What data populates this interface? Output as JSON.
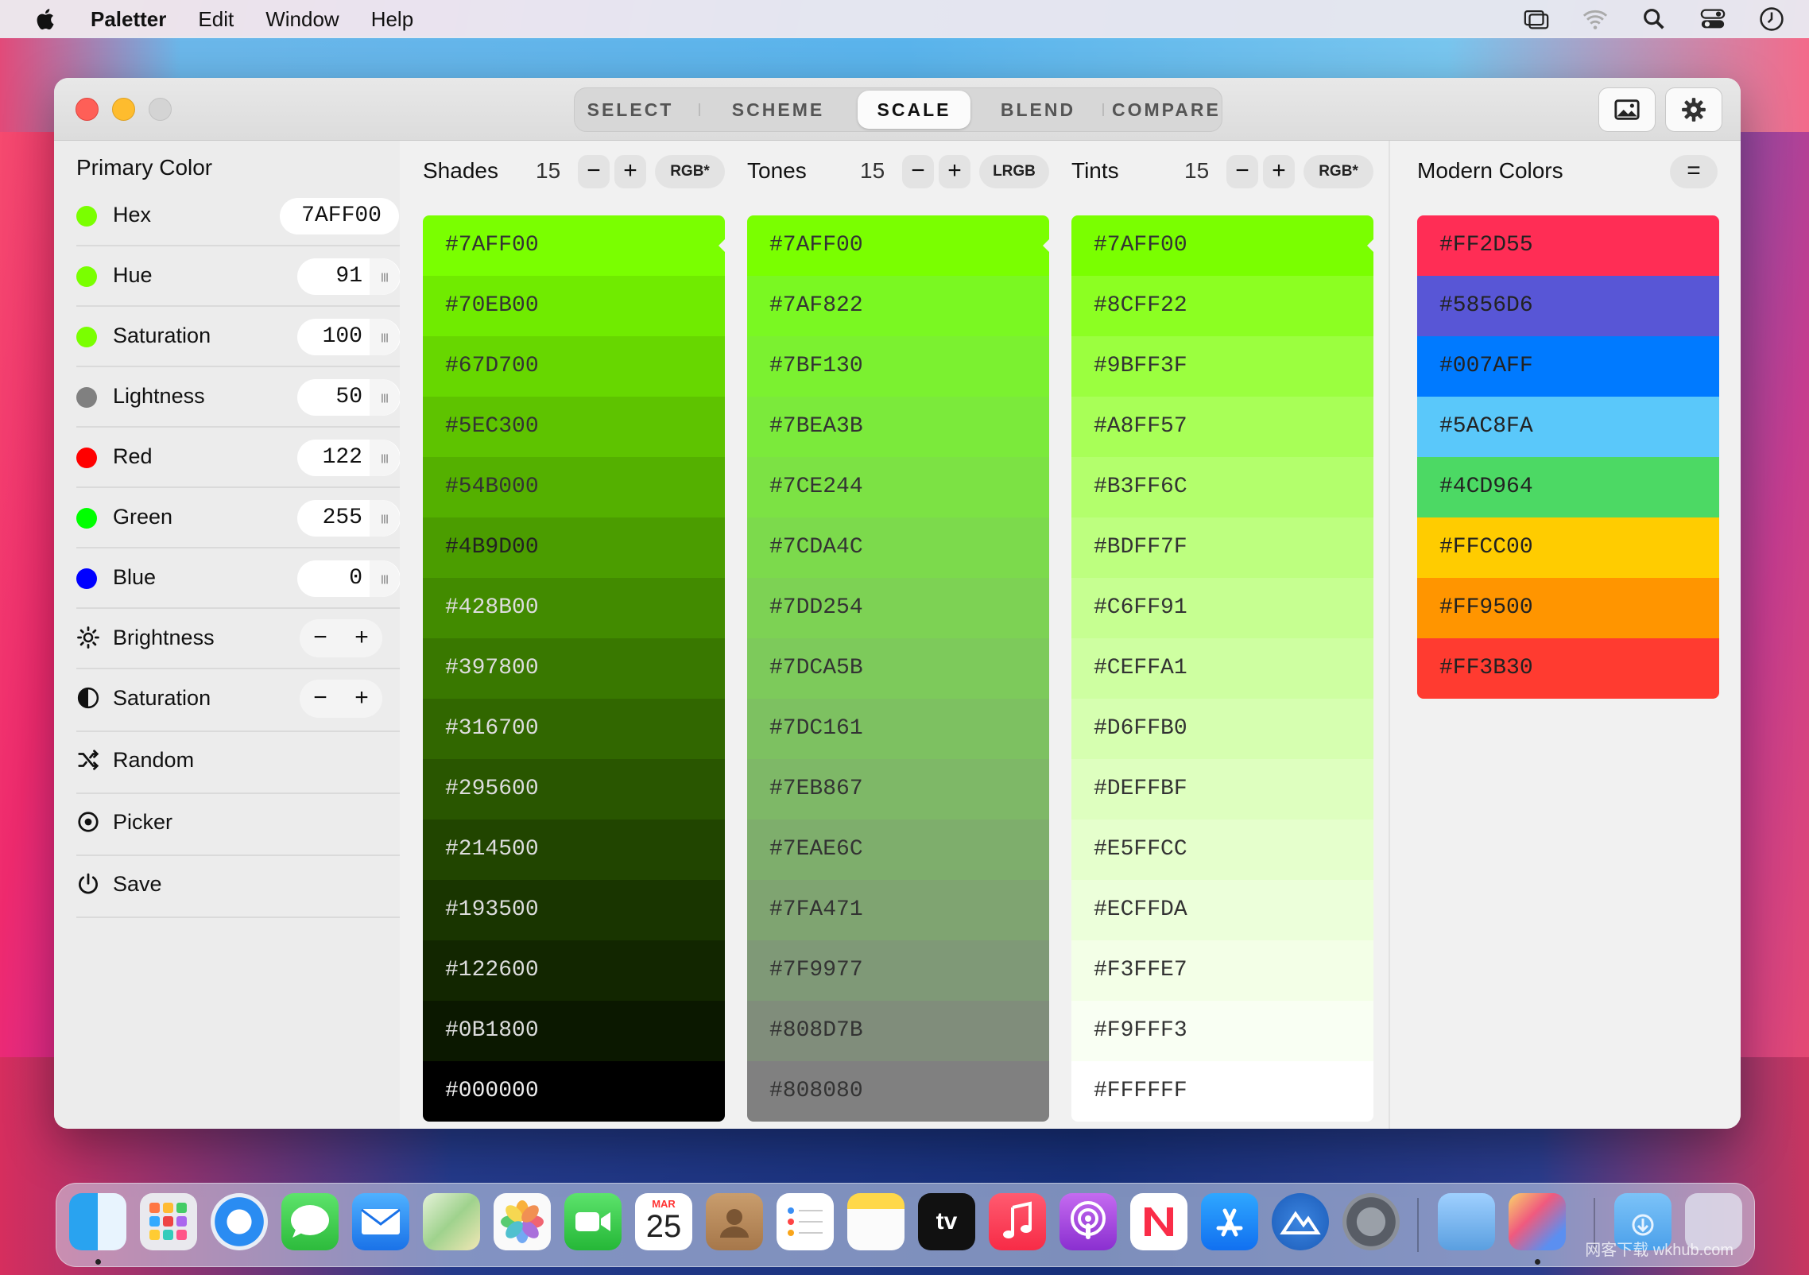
{
  "menubar": {
    "app_name": "Paletter",
    "items": [
      "Edit",
      "Window",
      "Help"
    ],
    "icons": [
      "screen-mirroring-icon",
      "wifi-icon",
      "search-icon",
      "control-center-icon",
      "clock-icon"
    ]
  },
  "toolbar": {
    "tabs": [
      "SELECT",
      "SCHEME",
      "SCALE",
      "BLEND",
      "COMPARE"
    ],
    "active_tab": "SCALE"
  },
  "sidebar": {
    "title": "Primary Color",
    "hex": {
      "label": "Hex",
      "value": "7AFF00",
      "color": "#7AFF00"
    },
    "fields": [
      {
        "label": "Hue",
        "value": "91",
        "color": "#7AFF00"
      },
      {
        "label": "Saturation",
        "value": "100",
        "color": "#7AFF00"
      },
      {
        "label": "Lightness",
        "value": "50",
        "color": "#808080"
      },
      {
        "label": "Red",
        "value": "122",
        "color": "#FF0000"
      },
      {
        "label": "Green",
        "value": "255",
        "color": "#00FF00"
      },
      {
        "label": "Blue",
        "value": "0",
        "color": "#0000FF"
      }
    ],
    "adjusters": [
      {
        "label": "Brightness",
        "icon": "brightness-icon",
        "minus": "−",
        "plus": "+"
      },
      {
        "label": "Saturation",
        "icon": "contrast-icon",
        "minus": "−",
        "plus": "+"
      }
    ],
    "actions": [
      {
        "label": "Random",
        "icon": "shuffle-icon"
      },
      {
        "label": "Picker",
        "icon": "target-icon"
      },
      {
        "label": "Save",
        "icon": "power-icon"
      }
    ]
  },
  "columns": [
    {
      "title": "Shades",
      "count": "15",
      "minus": "−",
      "plus": "+",
      "mode": "RGB*",
      "swatches": [
        "#7AFF00",
        "#70EB00",
        "#67D700",
        "#5EC300",
        "#54B000",
        "#4B9D00",
        "#428B00",
        "#397800",
        "#316700",
        "#295600",
        "#214500",
        "#193500",
        "#122600",
        "#0B1800",
        "#000000"
      ],
      "text_colors": [
        "#333",
        "#333",
        "#333",
        "#333",
        "#333",
        "#222",
        "#ddd",
        "#ddd",
        "#ddd",
        "#ddd",
        "#ddd",
        "#ddd",
        "#ddd",
        "#ddd",
        "#eee"
      ]
    },
    {
      "title": "Tones",
      "count": "15",
      "minus": "−",
      "plus": "+",
      "mode": "LRGB",
      "swatches": [
        "#7AFF00",
        "#7AF822",
        "#7BF130",
        "#7BEA3B",
        "#7CE244",
        "#7CDA4C",
        "#7DD254",
        "#7DCA5B",
        "#7DC161",
        "#7EB867",
        "#7EAE6C",
        "#7FA471",
        "#7F9977",
        "#808D7B",
        "#808080"
      ],
      "text_colors": [
        "#333",
        "#333",
        "#333",
        "#333",
        "#333",
        "#333",
        "#333",
        "#333",
        "#333",
        "#333",
        "#333",
        "#333",
        "#333",
        "#333",
        "#333"
      ]
    },
    {
      "title": "Tints",
      "count": "15",
      "minus": "−",
      "plus": "+",
      "mode": "RGB*",
      "swatches": [
        "#7AFF00",
        "#8CFF22",
        "#9BFF3F",
        "#A8FF57",
        "#B3FF6C",
        "#BDFF7F",
        "#C6FF91",
        "#CEFFA1",
        "#D6FFB0",
        "#DEFFBF",
        "#E5FFCC",
        "#ECFFDA",
        "#F3FFE7",
        "#F9FFF3",
        "#FFFFFF"
      ],
      "text_colors": [
        "#333",
        "#333",
        "#333",
        "#333",
        "#333",
        "#333",
        "#333",
        "#333",
        "#333",
        "#333",
        "#333",
        "#333",
        "#333",
        "#333",
        "#333"
      ]
    }
  ],
  "modern": {
    "title": "Modern Colors",
    "menu_symbol": "=",
    "swatches": [
      "#FF2D55",
      "#5856D6",
      "#007AFF",
      "#5AC8FA",
      "#4CD964",
      "#FFCC00",
      "#FF9500",
      "#FF3B30"
    ]
  },
  "dock": {
    "calendar_month": "MAR",
    "calendar_day": "25",
    "tv_label": "tv",
    "watermark": "网客下载 wkhub.com"
  }
}
